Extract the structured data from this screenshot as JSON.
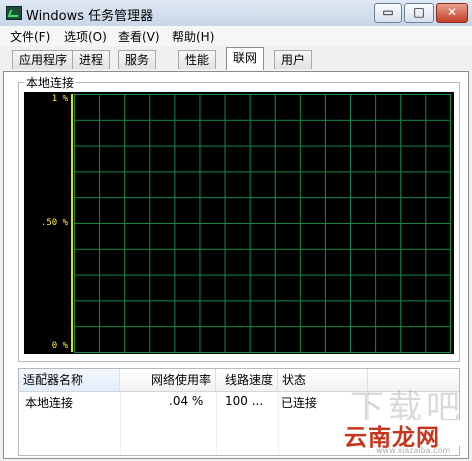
{
  "window": {
    "title": "Windows 任务管理器",
    "controls": {
      "minimize": "▭",
      "maximize": "□",
      "close": "✕"
    }
  },
  "menu": [
    "文件(F)",
    "选项(O)",
    "查看(V)",
    "帮助(H)"
  ],
  "tabs": [
    {
      "label": "应用程序",
      "active": false
    },
    {
      "label": "进程",
      "active": false
    },
    {
      "label": "服务",
      "active": false
    },
    {
      "label": "性能",
      "active": false
    },
    {
      "label": "联网",
      "active": true
    },
    {
      "label": "用户",
      "active": false
    }
  ],
  "group": {
    "label": "本地连接"
  },
  "graph": {
    "y_labels": [
      "1 %",
      ".50 %",
      "0 %"
    ],
    "colors": {
      "background": "#000000",
      "grid": "#138a4c",
      "axis": "#e8e000",
      "label": "#ffef3a"
    }
  },
  "table": {
    "columns": [
      "适配器名称",
      "网络使用率",
      "线路速度",
      "状态"
    ],
    "rows": [
      {
        "name": "本地连接",
        "usage": ".04 %",
        "speed": "100 ...",
        "status": "已连接"
      }
    ]
  },
  "watermark": {
    "big": "下载吧",
    "brand": "云南龙网",
    "url": "www.xiazaiba.com"
  }
}
